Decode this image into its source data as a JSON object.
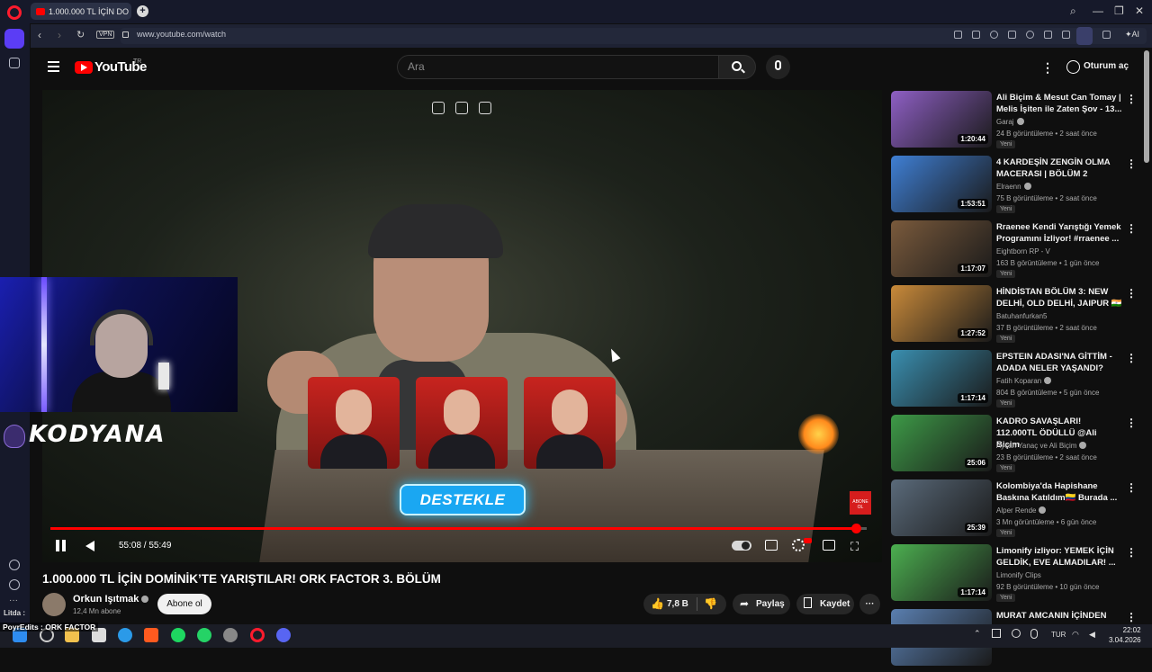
{
  "browser": {
    "tab_title": "1.000.000 TL İÇİN DO",
    "url": "www.youtube.com/watch",
    "vpn": "VPN",
    "ai_label": "AI"
  },
  "youtube": {
    "logo_text": "YouTube",
    "region": "TR",
    "search_placeholder": "Ara",
    "signin": "Oturum aç"
  },
  "player": {
    "time": "55:08 / 55:49",
    "progress": 0.987,
    "overlay_button": "DESTEKLE",
    "overlay_sub": "ABONE OL",
    "stream_name": "KODYANA"
  },
  "video": {
    "title": "1.000.000 TL İÇİN DOMİNİK’TE YARIŞTILAR! ORK FACTOR 3. BÖLÜM",
    "channel": "Orkun Işıtmak",
    "subscribers": "12,4 Mn abone",
    "subscribe_label": "Abone ol",
    "likes": "7,8 B",
    "share_label": "Paylaş",
    "save_label": "Kaydet"
  },
  "recommendations": [
    {
      "title": "Ali Biçim & Mesut Can Tomay | Melis İşiten ile Zaten Şov - 13...",
      "channel": "Garaj",
      "verified": true,
      "views": "24 B görüntüleme • 2 saat önce",
      "badge": "Yeni",
      "duration": "1:20:44",
      "color": "#8e5fc4"
    },
    {
      "title": "4 KARDEŞİN ZENGİN OLMA MACERASI | BÖLÜM 2",
      "channel": "Elraenn",
      "verified": true,
      "views": "75 B görüntüleme • 2 saat önce",
      "badge": "Yeni",
      "duration": "1:53:51",
      "color": "#3f7fd4"
    },
    {
      "title": "Rraenee Kendi Yarıştığı Yemek Programını İzliyor! #rraenee ...",
      "channel": "Eightborn RP - V",
      "verified": false,
      "views": "163 B görüntüleme • 1 gün önce",
      "badge": "Yeni",
      "duration": "1:17:07",
      "color": "#7a5a3c"
    },
    {
      "title": "HİNDİSTAN BÖLÜM 3: NEW DELHİ, OLD DELHİ, JAIPUR 🇮🇳",
      "channel": "Batuhanfurkan5",
      "verified": false,
      "views": "37 B görüntüleme • 2 saat önce",
      "badge": "Yeni",
      "duration": "1:27:52",
      "color": "#c98a3a"
    },
    {
      "title": "EPSTEIN ADASI'NA GİTTİM - ADADA NELER YAŞANDI?",
      "channel": "Fatih Koparan",
      "verified": true,
      "views": "804 B görüntüleme • 5 gün önce",
      "badge": "Yeni",
      "duration": "1:17:14",
      "color": "#3a8fb0"
    },
    {
      "title": "KADRO SAVAŞLARI! 112.000TL ÖDÜLLÜ @Ali Biçim",
      "channel": "Aycan Yanaç ve Ali Biçim",
      "verified": true,
      "views": "23 B görüntüleme • 2 saat önce",
      "badge": "Yeni",
      "duration": "25:06",
      "color": "#3d9a47"
    },
    {
      "title": "Kolombiya'da Hapishane Baskına Katıldım🇨🇴 Burada ...",
      "channel": "Alper Rende",
      "verified": true,
      "views": "3 Mn görüntüleme • 6 gün önce",
      "badge": "Yeni",
      "duration": "25:39",
      "color": "#5a6a7a"
    },
    {
      "title": "Limonify izliyor: YEMEK İÇİN GELDİK, EVE ALMADILAR! ...",
      "channel": "Limonify Clips",
      "verified": false,
      "views": "92 B görüntüleme • 10 gün önce",
      "badge": "Yeni",
      "duration": "1:17:14",
      "color": "#4caf50"
    },
    {
      "title": "MURAT AMCANIN İÇİNDEN",
      "channel": "",
      "verified": false,
      "views": "",
      "badge": "",
      "duration": "",
      "color": "#5a7fb0"
    }
  ],
  "taskbar": {
    "ticker": "PoyrEdits : ORK FACTOR",
    "chat_user": "Litda :",
    "lang": "TUR",
    "time": "22:02",
    "date": "3.04.2026"
  }
}
